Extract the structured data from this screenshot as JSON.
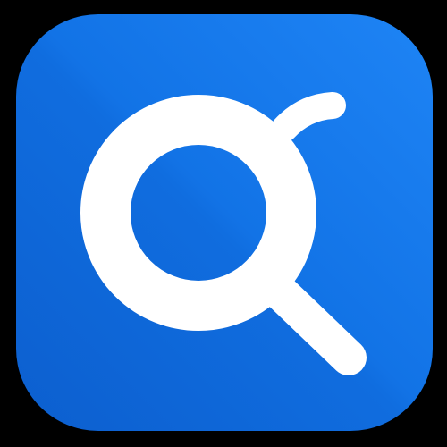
{
  "app_icon": {
    "icon": "search-magnifier-icon",
    "colors": {
      "background": "#000000",
      "tile_primary": "#1273e6",
      "tile_light": "#1e84f5",
      "tile_dark": "#0c5fcf",
      "glyph": "#ffffff"
    }
  }
}
